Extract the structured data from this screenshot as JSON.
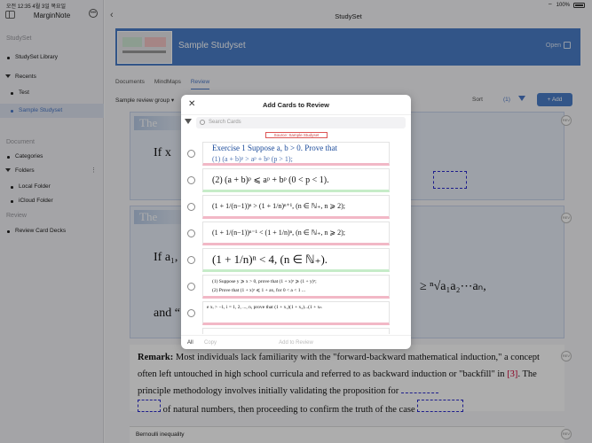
{
  "status": {
    "time": "오전 12:35",
    "date": "4월 3일 목요일",
    "battery": "100%"
  },
  "sidebar": {
    "app_title": "MarginNote",
    "section_studyset": "StudySet",
    "library": "StudySet Library",
    "recents": "Recents",
    "recent_items": [
      "Test",
      "Sample Studyset"
    ],
    "section_document": "Document",
    "categories": "Categories",
    "folders": "Folders",
    "folder_items": [
      "Local Folder",
      "iCloud Folder"
    ],
    "section_review": "Review",
    "review_card_decks": "Review Card Decks"
  },
  "nav": {
    "title": "StudySet"
  },
  "banner": {
    "name": "Sample Studyset",
    "open_label": "Open"
  },
  "tabs": [
    "Documents",
    "MindMaps",
    "Review"
  ],
  "controls": {
    "group": "Sample review group ▾",
    "sort": "Sort",
    "count": "(1)",
    "add": "Add"
  },
  "background": {
    "card1_heading": "The",
    "card1_text": "If x",
    "card2_heading": "The",
    "card2_text": "If a₁,",
    "card2_text_right": "≥ ⁿ√a₁a₂⋯aₙ,",
    "card2_text_and": "and “",
    "remark_label": "Remark:",
    "remark_text_1": " Most individuals lack familiarity with the \"forward-backward mathematical induction,\" a concept often left untouched in high school curricula and referred to as backward induction or \"backfill\" in ",
    "remark_ref": "[3]",
    "remark_text_2": ". The principle methodology involves initially validating the proposition for",
    "remark_text_3": "of natural numbers, then proceeding to confirm the truth of the case",
    "bottom_card": "Bernoulli inequality",
    "review_icon": "REV"
  },
  "modal": {
    "title": "Add Cards to Review",
    "search_placeholder": "Search Cards",
    "source_label": "Source: Sample Studyset",
    "cards": [
      {
        "text": "Exercise 1  Suppose a, b > 0. Prove that",
        "sub": "(1)  (a + b)ᵖ > aᵖ + bᵖ    (p > 1);"
      },
      {
        "text": "(2)  (a + b)ᵖ ⩽ aᵖ + bᵖ    (0 < p < 1)."
      },
      {
        "text": "(1 + 1/(n−1))ⁿ > (1 + 1/n)ⁿ⁺¹, (n ∈ ℕ₊, n ⩾ 2);"
      },
      {
        "text": "(1 + 1/(n−1))ⁿ⁻¹ < (1 + 1/n)ⁿ, (n ∈ ℕ₊, n ⩾ 2);"
      },
      {
        "text": "(1 + 1/n)ⁿ < 4, (n ∈ ℕ₊)."
      },
      {
        "text": "(1)  Suppose y ⩾ x > 0, prove that (1 + x)ʸ ⩾ (1 + y)ˣ;",
        "sub": "(2)  Prove that (1 + x)ᵃ ⩽ 1 + ax, for 0 < a < 1 ..."
      },
      {
        "text": "e xᵢ > −1, i = 1, 2, ..., n, prove that (1 + x₁)(1 + x₂)...(1 + xₙ"
      },
      {
        "text": ""
      }
    ],
    "footer_all": "All",
    "footer_copy": "Copy",
    "footer_add": "Add to Review"
  }
}
